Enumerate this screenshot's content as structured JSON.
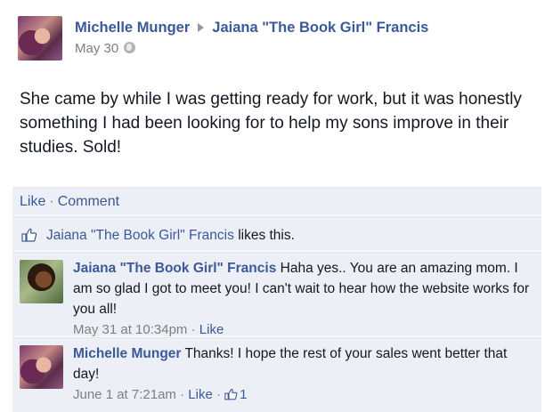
{
  "post": {
    "author": "Michelle Munger",
    "target": "Jaiana \"The Book Girl\" Francis",
    "date": "May 30",
    "text": "She came by while I was getting ready for work, but it was honestly something I had been looking for to help my sons improve in their studies. Sold!"
  },
  "actions": {
    "like_label": "Like",
    "separator": "·",
    "comment_label": "Comment"
  },
  "likes": {
    "name": "Jaiana \"The Book Girl\" Francis",
    "suffix": "likes this."
  },
  "comments": [
    {
      "author": "Jaiana \"The Book Girl\" Francis",
      "text": "Haha yes.. You are an amazing mom. I am so glad I got to meet you! I can't wait to hear how the website works for you all!",
      "timestamp": "May 31 at 10:34pm",
      "like_label": "Like",
      "separator": "·"
    },
    {
      "author": "Michelle Munger",
      "text": "Thanks! I hope the rest of your sales went better that day!",
      "timestamp": "June 1 at 7:21am",
      "like_label": "Like",
      "separator": "·",
      "like_count": "1"
    }
  ],
  "colors": {
    "link": "#3b5998",
    "meta": "#7f7f7f",
    "comment_bg": "#eceff5"
  }
}
